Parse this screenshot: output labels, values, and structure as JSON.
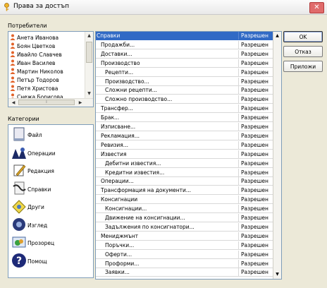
{
  "window": {
    "title": "Права за достъп",
    "close_glyph": "✕"
  },
  "users_label": "Потребители",
  "users": [
    "Анета Иванова",
    "Боян Цветков",
    "Ивайло Славчев",
    "Иван Василев",
    "Мартин Николов",
    "Петър Тодоров",
    "Петя Христова",
    "Снежа Борисова"
  ],
  "categories_label": "Категории",
  "categories": [
    {
      "label": "Файл",
      "icon": "file-icon"
    },
    {
      "label": "Операции",
      "icon": "operations-icon"
    },
    {
      "label": "Редакция",
      "icon": "edit-icon"
    },
    {
      "label": "Справки",
      "icon": "reports-icon"
    },
    {
      "label": "Други",
      "icon": "other-icon"
    },
    {
      "label": "Изглед",
      "icon": "view-icon"
    },
    {
      "label": "Прозорец",
      "icon": "window-icon"
    },
    {
      "label": "Помощ",
      "icon": "help-icon"
    }
  ],
  "rights": [
    {
      "name": "Справки",
      "value": "Разрешен",
      "level": 0,
      "selected": true
    },
    {
      "name": "Продажби...",
      "value": "Разрешен",
      "level": 1
    },
    {
      "name": "Доставки...",
      "value": "Разрешен",
      "level": 1
    },
    {
      "name": "Производство",
      "value": "Разрешен",
      "level": 1
    },
    {
      "name": "Рецепти...",
      "value": "Разрешен",
      "level": 2
    },
    {
      "name": "Производство...",
      "value": "Разрешен",
      "level": 2
    },
    {
      "name": "Сложни рецепти...",
      "value": "Разрешен",
      "level": 2
    },
    {
      "name": "Сложно производство...",
      "value": "Разрешен",
      "level": 2
    },
    {
      "name": "Трансфер...",
      "value": "Разрешен",
      "level": 1
    },
    {
      "name": "Брак...",
      "value": "Разрешен",
      "level": 1
    },
    {
      "name": "Изписване...",
      "value": "Разрешен",
      "level": 1
    },
    {
      "name": "Рекламация...",
      "value": "Разрешен",
      "level": 1
    },
    {
      "name": "Ревизия...",
      "value": "Разрешен",
      "level": 1
    },
    {
      "name": "Известия",
      "value": "Разрешен",
      "level": 1
    },
    {
      "name": "Дебитни известия...",
      "value": "Разрешен",
      "level": 2
    },
    {
      "name": "Кредитни известия...",
      "value": "Разрешен",
      "level": 2
    },
    {
      "name": "Операции...",
      "value": "Разрешен",
      "level": 1
    },
    {
      "name": "Трансформация на документи...",
      "value": "Разрешен",
      "level": 1
    },
    {
      "name": "Консигнации",
      "value": "Разрешен",
      "level": 1
    },
    {
      "name": "Консигнации...",
      "value": "Разрешен",
      "level": 2
    },
    {
      "name": "Движение на консигнации...",
      "value": "Разрешен",
      "level": 2
    },
    {
      "name": "Задължения по консигнатори...",
      "value": "Разрешен",
      "level": 2
    },
    {
      "name": "Мениджмънт",
      "value": "Разрешен",
      "level": 1
    },
    {
      "name": "Поръчки...",
      "value": "Разрешен",
      "level": 2
    },
    {
      "name": "Оферти...",
      "value": "Разрешен",
      "level": 2
    },
    {
      "name": "Проформи...",
      "value": "Разрешен",
      "level": 2
    },
    {
      "name": "Заявки...",
      "value": "Разрешен",
      "level": 2
    }
  ],
  "buttons": {
    "ok": "OK",
    "cancel": "Отказ",
    "apply": "Приложи"
  },
  "colors": {
    "selection": "#316ac5",
    "user_icon": "#e2632a"
  }
}
